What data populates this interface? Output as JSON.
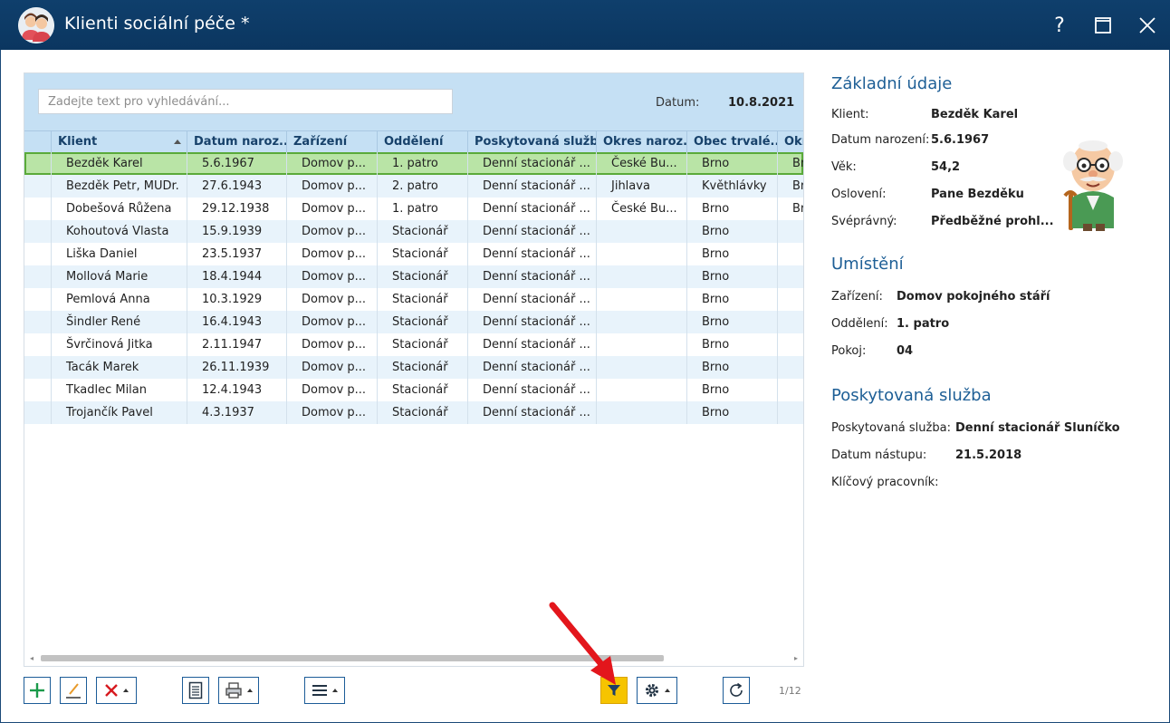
{
  "window": {
    "title": "Klienti sociální péče *",
    "help_label": "?"
  },
  "search": {
    "placeholder": "Zadejte text pro vyhledávání..."
  },
  "date": {
    "label": "Datum:",
    "value": "10.8.2021"
  },
  "columns": [
    "Klient",
    "Datum naroz...",
    "Zařízení",
    "Oddělení",
    "Poskytovaná služba",
    "Okres naroz...",
    "Obec trvalé...",
    "Okr"
  ],
  "rows": [
    [
      "Bezděk Karel",
      "5.6.1967",
      "Domov p...",
      "1. patro",
      "Denní stacionář ...",
      "České Bu...",
      "Brno",
      "Br"
    ],
    [
      "Bezděk Petr, MUDr.",
      "27.6.1943",
      "Domov p...",
      "2. patro",
      "Denní stacionář ...",
      "Jihlava",
      "Květhlávky",
      "Br"
    ],
    [
      "Dobešová Růžena",
      "29.12.1938",
      "Domov p...",
      "1. patro",
      "Denní stacionář ...",
      "České Bu...",
      "Brno",
      "Br"
    ],
    [
      "Kohoutová Vlasta",
      "15.9.1939",
      "Domov p...",
      "Stacionář",
      "Denní stacionář ...",
      "",
      "Brno",
      ""
    ],
    [
      "Liška Daniel",
      "23.5.1937",
      "Domov p...",
      "Stacionář",
      "Denní stacionář ...",
      "",
      "Brno",
      ""
    ],
    [
      "Mollová Marie",
      "18.4.1944",
      "Domov p...",
      "Stacionář",
      "Denní stacionář ...",
      "",
      "Brno",
      ""
    ],
    [
      "Pemlová Anna",
      "10.3.1929",
      "Domov p...",
      "Stacionář",
      "Denní stacionář ...",
      "",
      "Brno",
      ""
    ],
    [
      "Šindler René",
      "16.4.1943",
      "Domov p...",
      "Stacionář",
      "Denní stacionář ...",
      "",
      "Brno",
      ""
    ],
    [
      "Švrčinová Jitka",
      "2.11.1947",
      "Domov p...",
      "Stacionář",
      "Denní stacionář ...",
      "",
      "Brno",
      ""
    ],
    [
      "Tacák Marek",
      "26.11.1939",
      "Domov p...",
      "Stacionář",
      "Denní stacionář ...",
      "",
      "Brno",
      ""
    ],
    [
      "Tkadlec Milan",
      "12.4.1943",
      "Domov p...",
      "Stacionář",
      "Denní stacionář ...",
      "",
      "Brno",
      ""
    ],
    [
      "Trojančík Pavel",
      "4.3.1937",
      "Domov p...",
      "Stacionář",
      "Denní stacionář ...",
      "",
      "Brno",
      ""
    ]
  ],
  "selected_row": 0,
  "pager": "1/12",
  "detail": {
    "basic": {
      "title": "Základní údaje",
      "client_label": "Klient:",
      "client": "Bezděk Karel",
      "birth_label": "Datum narození:",
      "birth": "5.6.1967",
      "age_label": "Věk:",
      "age": "54,2",
      "salutation_label": "Oslovení:",
      "salutation": "Pane Bezděku",
      "legal_label": "Svéprávný:",
      "legal": "Předběžné prohl..."
    },
    "placement": {
      "title": "Umístění",
      "facility_label": "Zařízení:",
      "facility": "Domov pokojného stáří",
      "dept_label": "Oddělení:",
      "dept": "1. patro",
      "room_label": "Pokoj:",
      "room": "04"
    },
    "service": {
      "title": "Poskytovaná služba",
      "service_label": "Poskytovaná služba:",
      "service": "Denní stacionář Sluníčko",
      "start_label": "Datum nástupu:",
      "start": "21.5.2018",
      "worker_label": "Klíčový pracovník:",
      "worker": ""
    }
  },
  "toolbar": {
    "icons": [
      "add-icon",
      "edit-icon",
      "delete-icon",
      "document-icon",
      "print-icon",
      "menu-icon",
      "filter-icon",
      "settings-icon",
      "refresh-icon"
    ]
  },
  "colors": {
    "titlebar": "#0f3f6c",
    "selected_row": "#b9e4a6",
    "accent_blue": "#1e5f96",
    "filter_button": "#f6c400",
    "arrow": "#e3161c"
  }
}
